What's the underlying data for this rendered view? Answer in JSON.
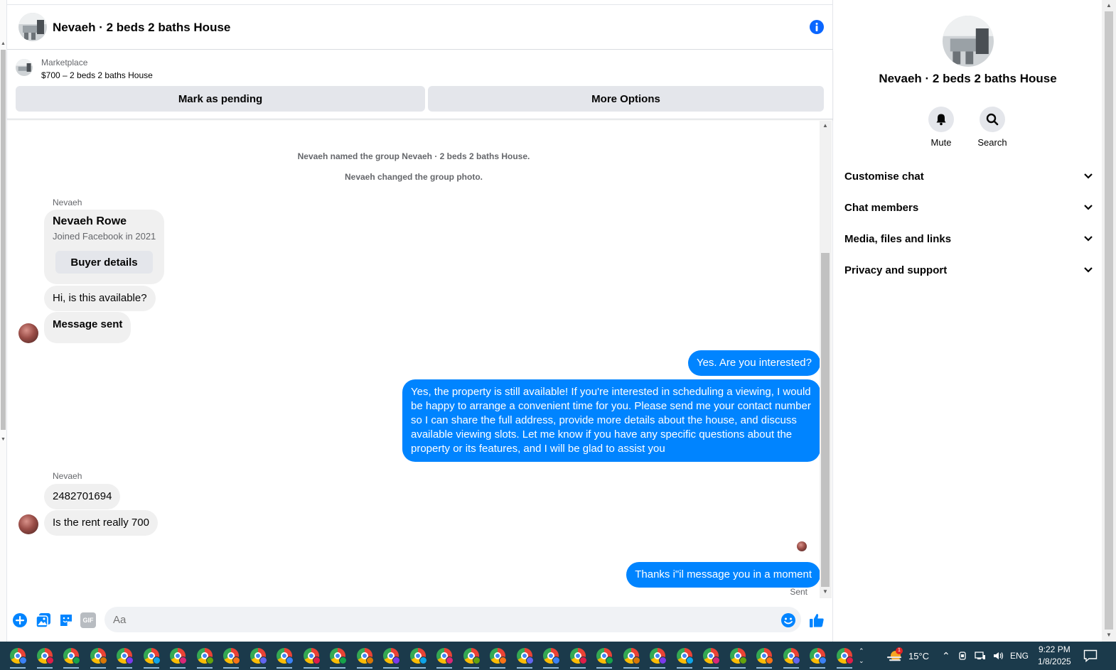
{
  "conversation": {
    "title": "Nevaeh · 2 beds 2 baths House"
  },
  "listing": {
    "source": "Marketplace",
    "price_title": "$700 – 2 beds 2 baths House",
    "mark_pending_label": "Mark as pending",
    "more_options_label": "More Options"
  },
  "messages": {
    "system_1": "Nevaeh named the group Nevaeh · 2 beds 2 baths House.",
    "system_2": "Nevaeh changed the group photo.",
    "sender_1": "Nevaeh",
    "buyer_card": {
      "name": "Nevaeh Rowe",
      "joined": "Joined Facebook in 2021",
      "details_button": "Buyer details"
    },
    "in_1": "Hi, is this available?",
    "in_2": "Message sent",
    "out_1": "Yes. Are you interested?",
    "out_2": "Yes, the property is still available! If you're interested in scheduling a viewing, I would be happy to arrange a convenient time for you. Please send me your contact number so I can share the full address, provide more details about the house, and discuss available viewing slots. Let me know if you have any specific questions about the property or its features, and I will be glad to assist you",
    "sender_2": "Nevaeh",
    "in_3": "2482701694",
    "in_4": "Is the rent really 700",
    "out_3": "Thanks i\"il message you in a moment",
    "status": "Sent"
  },
  "composer": {
    "placeholder": "Aa",
    "icons": [
      "plus-circle-icon",
      "photo-icon",
      "sticker-icon",
      "gif-icon",
      "emoji-icon",
      "thumbs-up-icon"
    ],
    "gif_text": "GIF"
  },
  "panel": {
    "title": "Nevaeh · 2 beds 2 baths House",
    "mute_label": "Mute",
    "search_label": "Search",
    "sections": [
      "Customise chat",
      "Chat members",
      "Media, files and links",
      "Privacy and support"
    ]
  },
  "taskbar": {
    "weather": "15°C",
    "weather_badge": "1",
    "language": "ENG",
    "time": "9:22 PM",
    "date": "1/8/2025",
    "profile_colors": [
      "#3b82f6",
      "#e11d48",
      "#16a34a",
      "#d97706",
      "#7c3aed",
      "#0ea5e9",
      "#db2777",
      "#65a30d",
      "#f97316",
      "#6366f1"
    ]
  },
  "colors": {
    "accent": "#0084ff",
    "info": "#0a66ff",
    "taskbar": "#1b3a4b"
  }
}
